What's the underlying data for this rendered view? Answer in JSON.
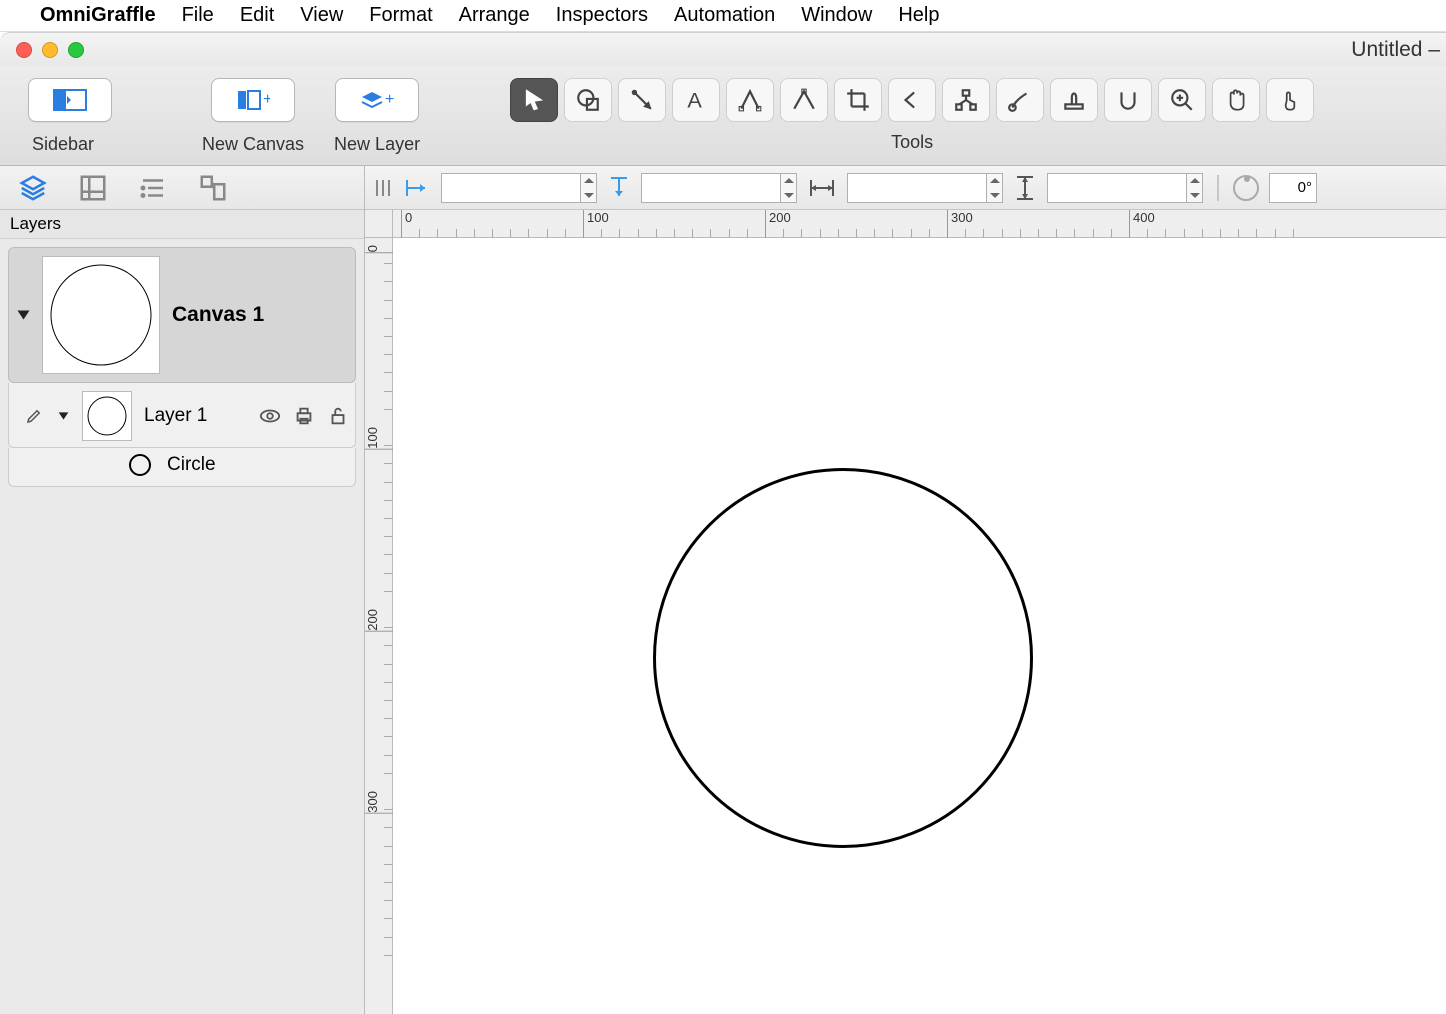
{
  "menubar": {
    "app": "OmniGraffle",
    "items": [
      "File",
      "Edit",
      "View",
      "Format",
      "Arrange",
      "Inspectors",
      "Automation",
      "Window",
      "Help"
    ]
  },
  "window": {
    "title": "Untitled –"
  },
  "toolbar": {
    "sidebar_label": "Sidebar",
    "newcanvas_label": "New Canvas",
    "newlayer_label": "New Layer",
    "tools_label": "Tools"
  },
  "sidebar": {
    "section": "Layers",
    "canvas_name": "Canvas 1",
    "layer_name": "Layer 1",
    "shape_name": "Circle"
  },
  "options": {
    "angle": "0°"
  },
  "ruler": {
    "h_majors": [
      0,
      100,
      200,
      300,
      400
    ],
    "v_majors": [
      0,
      100,
      200,
      300
    ]
  }
}
